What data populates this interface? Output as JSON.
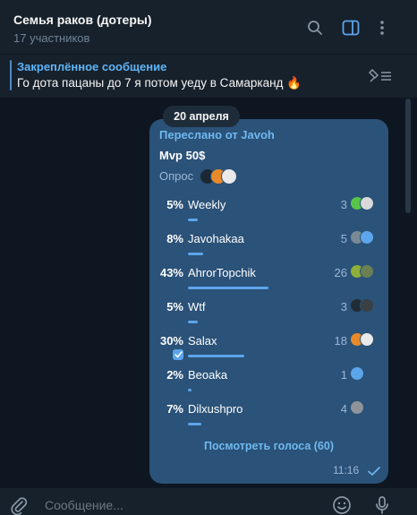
{
  "header": {
    "title": "Семья раков (дотеры)",
    "subtitle": "17 участников",
    "icons": [
      "search-icon",
      "sidebar-toggle-icon",
      "more-vertical-icon"
    ]
  },
  "pinned": {
    "title": "Закреплённое сообщение",
    "text": "Го дота пацаны до 7 я потом уеду в Самарканд 🔥",
    "icon": "unpin-list-icon"
  },
  "date_badge": "20 апреля",
  "message": {
    "forwarded": "Переслано от Javoh",
    "question": "Mvp 50$",
    "poll_type": "Опрос",
    "options": [
      {
        "percent": "5%",
        "name": "Weekly",
        "count": "3",
        "fraction": 0.05,
        "chosen": false
      },
      {
        "percent": "8%",
        "name": "Javohakaa",
        "count": "5",
        "fraction": 0.08,
        "chosen": false
      },
      {
        "percent": "43%",
        "name": "AhrorTopchik",
        "count": "26",
        "fraction": 0.43,
        "chosen": false
      },
      {
        "percent": "5%",
        "name": "Wtf",
        "count": "3",
        "fraction": 0.05,
        "chosen": false
      },
      {
        "percent": "30%",
        "name": "Salax",
        "count": "18",
        "fraction": 0.3,
        "chosen": true
      },
      {
        "percent": "2%",
        "name": "Beoaka",
        "count": "1",
        "fraction": 0.02,
        "chosen": false
      },
      {
        "percent": "7%",
        "name": "Dilxushpro",
        "count": "4",
        "fraction": 0.07,
        "chosen": false
      }
    ],
    "view_votes": "Посмотреть голоса (60)",
    "time": "11:16",
    "status": "read-check-icon"
  },
  "composer": {
    "placeholder": "Сообщение...",
    "icons": [
      "attach-icon",
      "emoji-icon",
      "microphone-icon"
    ]
  },
  "colors": {
    "background": "#0e1621",
    "panel": "#17212b",
    "bubble": "#2b5278",
    "accent": "#5ca5eb",
    "link": "#6fb9f0"
  }
}
